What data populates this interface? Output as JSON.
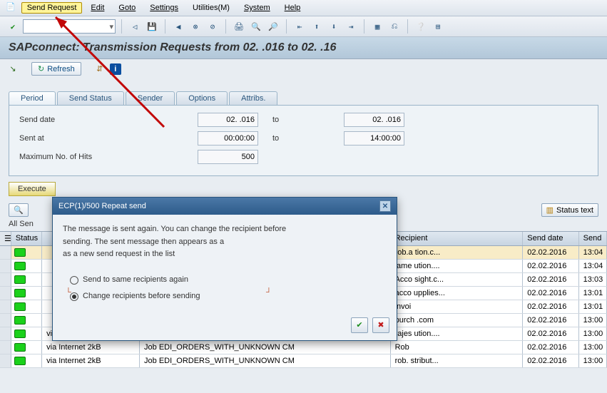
{
  "menu": {
    "send_request": "Send Request",
    "edit": "Edit",
    "goto": "Goto",
    "settings": "Settings",
    "utilities": "Utilities(M)",
    "system": "System",
    "help": "Help"
  },
  "title": "SAPconnect: Transmission Requests from 02.    .016 to 02.    .16",
  "subtoolbar": {
    "refresh": "Refresh"
  },
  "tabs": {
    "period": "Period",
    "send_status": "Send Status",
    "sender": "Sender",
    "options": "Options",
    "attribs": "Attribs."
  },
  "form": {
    "send_date_label": "Send date",
    "send_date_from": "02.     .016",
    "to": "to",
    "send_date_to": "02.     .016",
    "sent_at_label": "Sent at",
    "sent_at_from": "00:00:00",
    "sent_at_to": "14:00:00",
    "max_hits_label": "Maximum No. of Hits",
    "max_hits": "500"
  },
  "exec_btn": "Execute",
  "grid_tb": {
    "status_text": "Status text"
  },
  "info_line": "All Sen",
  "grid_headers": {
    "status": "Status",
    "recipient": "Recipient",
    "send_date": "Send date",
    "send_time": "Send"
  },
  "rows": [
    {
      "addr": "",
      "title": "",
      "recip": "rob.a                               tion.c...",
      "date": "02.02.2016",
      "time": "13:04",
      "sel": true
    },
    {
      "addr": "",
      "title": "",
      "recip": "jame                               ution....",
      "date": "02.02.2016",
      "time": "13:04",
      "sel": false
    },
    {
      "addr": "",
      "title": "",
      "recip": "Acco                                 sight.c...",
      "date": "02.02.2016",
      "time": "13:03",
      "sel": false
    },
    {
      "addr": "",
      "title": "",
      "recip": "acco                              upplies...",
      "date": "02.02.2016",
      "time": "13:01",
      "sel": false
    },
    {
      "addr": "",
      "title": "",
      "recip": "invoi                                           ",
      "date": "02.02.2016",
      "time": "13:01",
      "sel": false
    },
    {
      "addr": "",
      "title": "",
      "recip": "purch                           .com",
      "date": "02.02.2016",
      "time": "13:00",
      "sel": false
    },
    {
      "addr": "via Internet 2kB",
      "title": "Job EDI_ORDERS_WITH_UNKNOWN   CM",
      "recip": "rajes                                    ution....",
      "date": "02.02.2016",
      "time": "13:00",
      "sel": false
    },
    {
      "addr": "via Internet 2kB",
      "title": "Job EDI_ORDERS_WITH_UNKNOWN   CM",
      "recip": "Rob                                           ",
      "date": "02.02.2016",
      "time": "13:00",
      "sel": false
    },
    {
      "addr": "via Internet 2kB",
      "title": "Job EDI_ORDERS_WITH_UNKNOWN   CM",
      "recip": "rob.                               stribut...",
      "date": "02.02.2016",
      "time": "13:00",
      "sel": false
    }
  ],
  "dialog": {
    "title": "ECP(1)/500 Repeat send",
    "msg1": "The message is sent again. You can change the recipient before",
    "msg2": "sending. The sent message then appears as a",
    "msg3": "as a new send request in the list",
    "radio_same": "Send to same recipients again",
    "radio_change": "Change recipients before sending"
  }
}
